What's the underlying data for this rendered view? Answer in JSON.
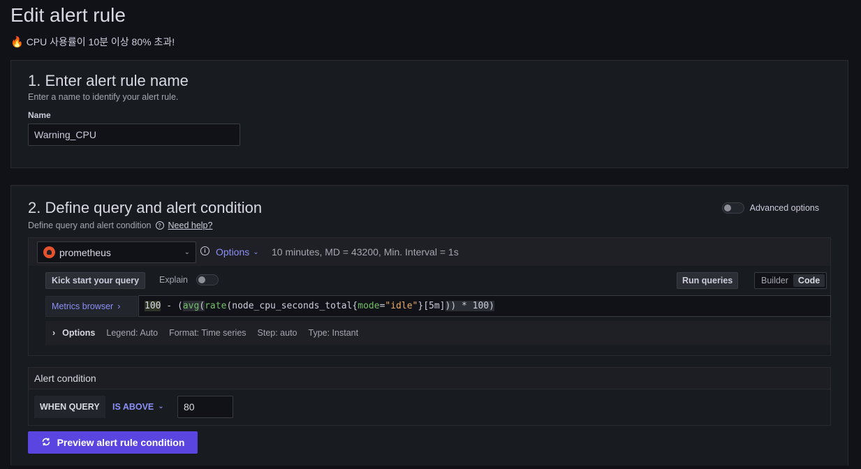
{
  "page": {
    "title": "Edit alert rule",
    "subtitle_icon": "fire-icon",
    "subtitle": "CPU 사용률이 10분 이상 80% 초과!"
  },
  "section1": {
    "title": "1. Enter alert rule name",
    "description": "Enter a name to identify your alert rule.",
    "name_label": "Name",
    "name_value": "Warning_CPU"
  },
  "section2": {
    "title": "2. Define query and alert condition",
    "description": "Define query and alert condition",
    "help_link": "Need help?",
    "advanced_options_label": "Advanced options",
    "advanced_options_enabled": false,
    "query": {
      "datasource": "prometheus",
      "options_label": "Options",
      "options_summary": "10 minutes, MD = 43200, Min. Interval = 1s",
      "kick_start_label": "Kick start your query",
      "explain_label": "Explain",
      "explain_enabled": false,
      "run_queries_label": "Run queries",
      "mode_builder": "Builder",
      "mode_code": "Code",
      "active_mode": "Code",
      "metrics_browser_label": "Metrics browser",
      "expr": {
        "p1": "100",
        "p2": " - (",
        "p3": "avg",
        "p4": "(",
        "p5": "rate",
        "p6": "(node_cpu_seconds_total{",
        "p7": "mode",
        "p8": "=",
        "p9": "\"idle\"",
        "p10": "}[5m]",
        "p11": "))",
        "p12": " * 100)"
      },
      "row_options_label": "Options",
      "legend": "Legend: Auto",
      "format": "Format: Time series",
      "step": "Step: auto",
      "type": "Type: Instant"
    },
    "condition": {
      "title": "Alert condition",
      "when_label": "WHEN QUERY",
      "operator": "IS ABOVE",
      "threshold": "80"
    },
    "preview_button": "Preview alert rule condition"
  },
  "colors": {
    "background": "#111217",
    "panel": "#181b1f",
    "accent": "#8c8ff7",
    "primary_button": "#5b45e0",
    "prometheus": "#e6522c"
  }
}
